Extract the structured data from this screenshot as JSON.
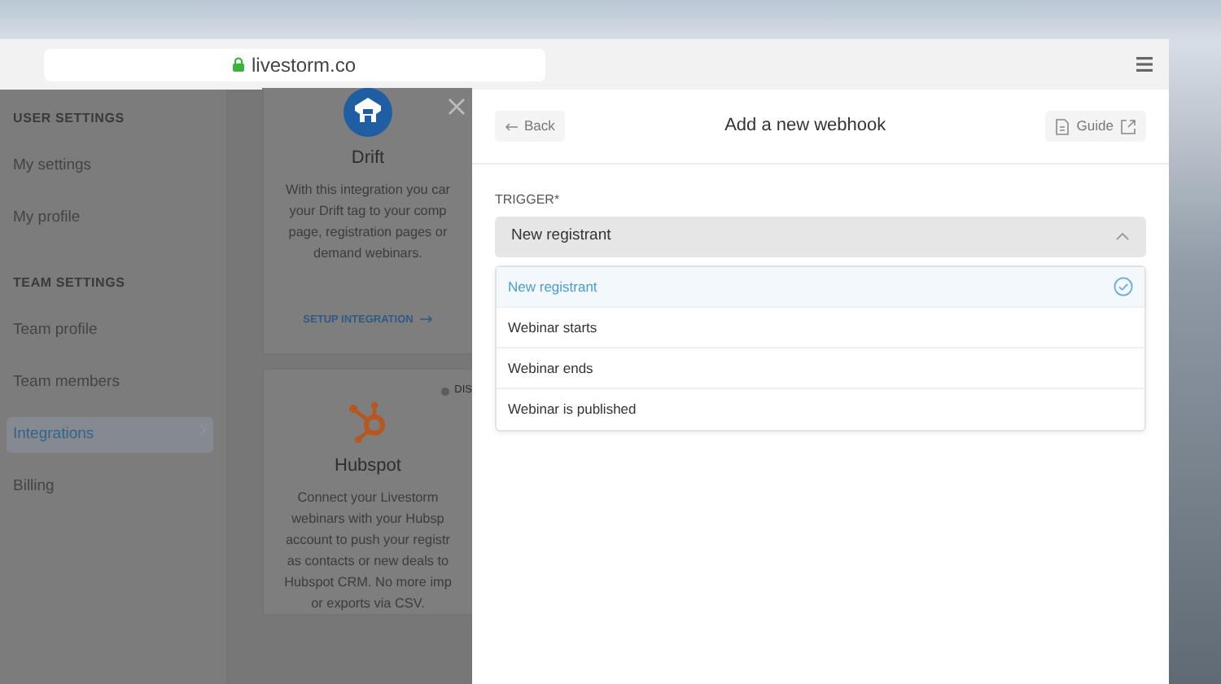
{
  "browser": {
    "url": "livestorm.co"
  },
  "sidebar": {
    "sections": [
      {
        "title": "USER SETTINGS",
        "items": [
          {
            "label": "My settings",
            "selected": false
          },
          {
            "label": "My profile",
            "selected": false
          }
        ]
      },
      {
        "title": "TEAM SETTINGS",
        "items": [
          {
            "label": "Team profile",
            "selected": false
          },
          {
            "label": "Team members",
            "selected": false
          },
          {
            "label": "Integrations",
            "selected": true
          },
          {
            "label": "Billing",
            "selected": false
          }
        ]
      }
    ]
  },
  "integrations": [
    {
      "kind": "drift",
      "name": "Drift",
      "description": "With this integration you car\nyour Drift tag to your comp\npage, registration pages or\ndemand webinars.",
      "action": "SETUP INTEGRATION"
    },
    {
      "kind": "hubspot",
      "name": "Hubspot",
      "status": "DIS",
      "description": "Connect your Livestorm\nwebinars with your Hubsp\naccount to push your registr\nas contacts or new deals to\nHubspot CRM. No more imp\nor exports via CSV."
    }
  ],
  "modal": {
    "back": "Back",
    "title": "Add a new webhook",
    "guide": "Guide",
    "trigger": {
      "label": "TRIGGER*",
      "value": "New registrant",
      "expanded": true,
      "options": [
        {
          "label": "New registrant",
          "selected": true
        },
        {
          "label": "Webinar starts",
          "selected": false
        },
        {
          "label": "Webinar ends",
          "selected": false
        },
        {
          "label": "Webinar is published",
          "selected": false
        }
      ]
    }
  }
}
